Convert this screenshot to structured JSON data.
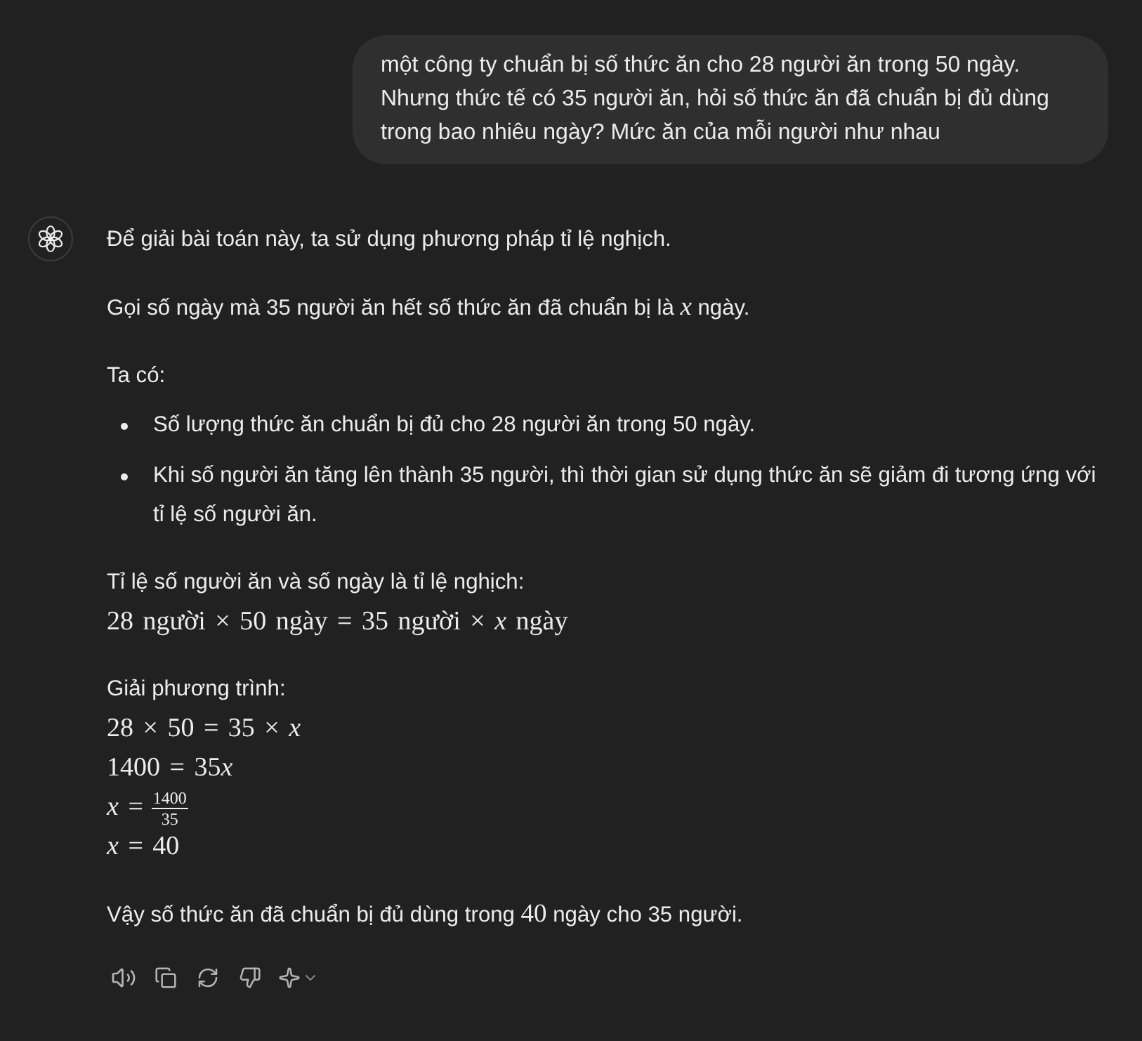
{
  "user_message": "một công ty chuẩn bị số thức ăn cho 28 người ăn trong 50 ngày. Nhưng thức tế có 35 người ăn, hỏi số thức ăn đã chuẩn bị đủ dùng trong bao nhiêu ngày? Mức ăn của mỗi người như nhau",
  "assistant": {
    "blocks": [
      {
        "kind": "paragraph",
        "segments": [
          {
            "kind": "text",
            "text": "Để giải bài toán này, ta sử dụng phương pháp tỉ lệ nghịch."
          }
        ]
      },
      {
        "kind": "paragraph",
        "segments": [
          {
            "kind": "text",
            "text": "Gọi số ngày mà 35 người ăn hết số thức ăn đã chuẩn bị là "
          },
          {
            "kind": "variable",
            "text": "x"
          },
          {
            "kind": "text",
            "text": " ngày."
          }
        ]
      },
      {
        "kind": "paragraph",
        "segments": [
          {
            "kind": "text",
            "text": "Ta có:"
          }
        ]
      },
      {
        "kind": "bullets",
        "items": [
          "Số lượng thức ăn chuẩn bị đủ cho 28 người ăn trong 50 ngày.",
          "Khi số người ăn tăng lên thành 35 người, thì thời gian sử dụng thức ăn sẽ giảm đi tương ứng với tỉ lệ số người ăn."
        ]
      },
      {
        "kind": "derivation",
        "label": "Tỉ lệ số người ăn và số ngày là tỉ lệ nghịch:",
        "lines": [
          {
            "kind": "equation",
            "segments": [
              {
                "kind": "math",
                "text": "28 người × 50 ngày = 35 người × "
              },
              {
                "kind": "variable",
                "text": "x"
              },
              {
                "kind": "math",
                "text": " ngày"
              }
            ]
          }
        ]
      },
      {
        "kind": "derivation",
        "label": "Giải phương trình:",
        "lines": [
          {
            "kind": "equation",
            "segments": [
              {
                "kind": "math",
                "text": "28 × 50 = 35 × "
              },
              {
                "kind": "variable",
                "text": "x"
              }
            ]
          },
          {
            "kind": "equation",
            "segments": [
              {
                "kind": "math",
                "text": "1400 = 35"
              },
              {
                "kind": "variable",
                "text": "x"
              }
            ]
          },
          {
            "kind": "fraction",
            "segments": [
              {
                "kind": "variable",
                "text": "x"
              },
              {
                "kind": "math",
                "text": " ="
              }
            ],
            "numerator": "1400",
            "denominator": "35"
          },
          {
            "kind": "equation",
            "segments": [
              {
                "kind": "variable",
                "text": "x"
              },
              {
                "kind": "math",
                "text": " = 40"
              }
            ]
          }
        ]
      },
      {
        "kind": "paragraph",
        "segments": [
          {
            "kind": "text",
            "text": "Vậy số thức ăn đã chuẩn bị đủ dùng trong "
          },
          {
            "kind": "math",
            "text": "40"
          },
          {
            "kind": "text",
            "text": " ngày cho 35 người."
          }
        ]
      }
    ]
  }
}
